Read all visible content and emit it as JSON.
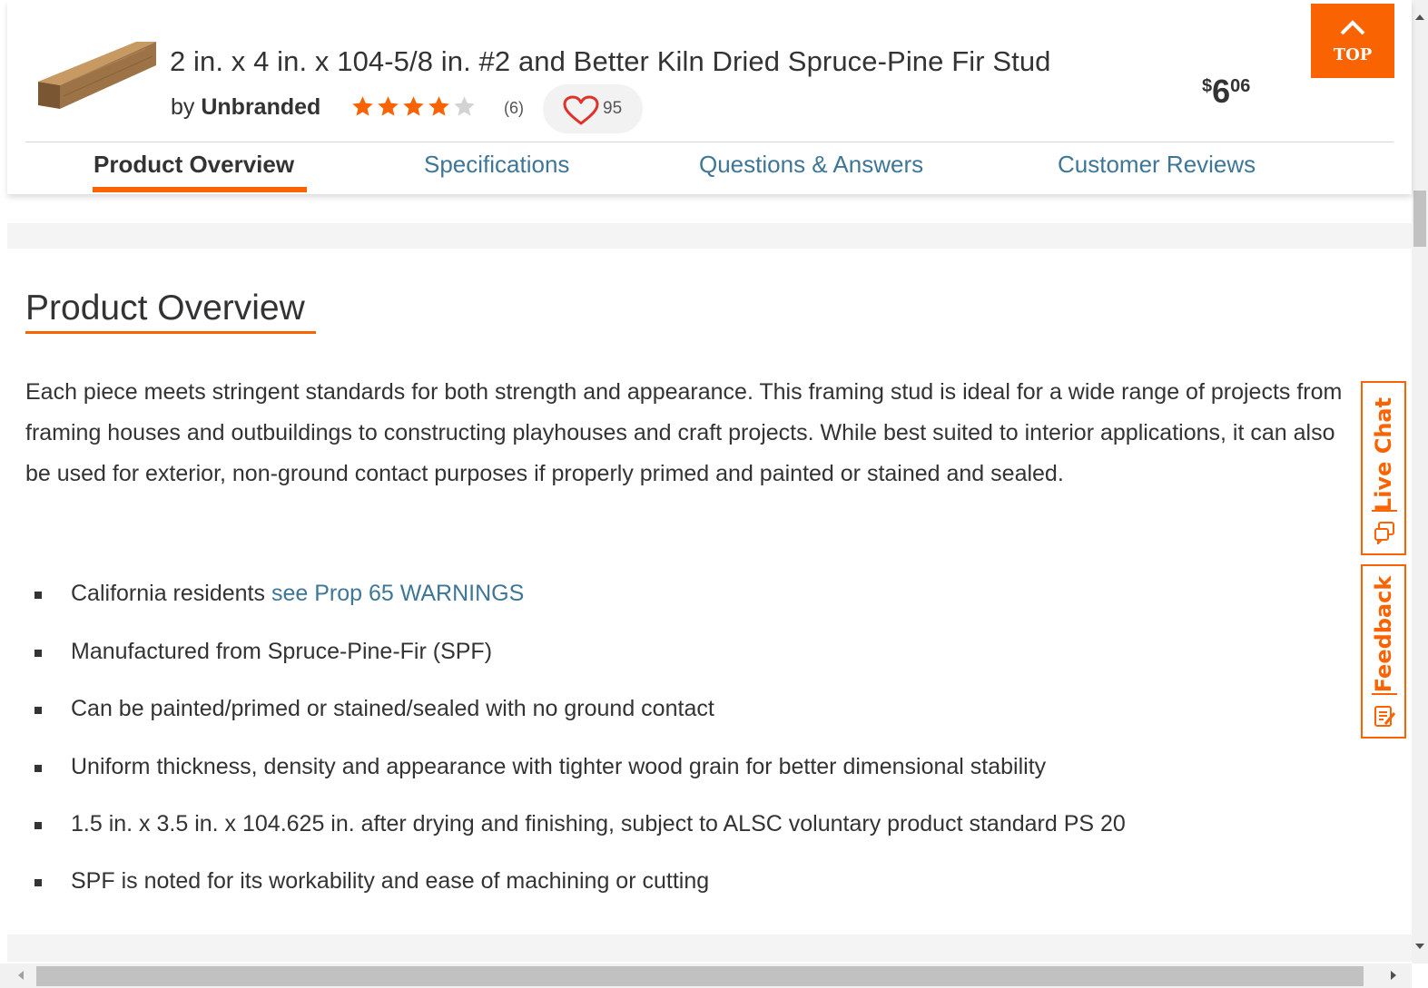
{
  "header": {
    "product_title": "2 in. x 4 in. x 104-5/8 in. #2 and Better Kiln Dried Spruce-Pine Fir Stud",
    "by_prefix": "by",
    "brand": "Unbranded",
    "rating": {
      "value": 4,
      "max": 5
    },
    "review_count": "(6)",
    "favorites_count": "95",
    "price": {
      "currency": "$",
      "dollars": "6",
      "cents": "06"
    },
    "top_button_label": "TOP",
    "tabs": [
      {
        "label": "Product Overview",
        "active": true
      },
      {
        "label": "Specifications",
        "active": false
      },
      {
        "label": "Questions & Answers",
        "active": false
      },
      {
        "label": "Customer Reviews",
        "active": false
      }
    ]
  },
  "overview": {
    "title": "Product Overview",
    "description": "Each piece meets stringent standards for both strength and appearance. This framing stud is ideal for a wide range of projects from framing houses and outbuildings to constructing playhouses and craft projects. While best suited to interior applications, it can also be used for exterior, non-ground contact purposes if properly primed and painted or stained and sealed.",
    "prop65_prefix": "California residents",
    "prop65_link": "see Prop 65 WARNINGS",
    "bullets": [
      "Manufactured from Spruce-Pine-Fir (SPF)",
      "Can be painted/primed or stained/sealed with no ground contact",
      "Uniform thickness, density and appearance with tighter wood grain for better dimensional stability",
      "1.5 in. x 3.5 in. x 104.625 in. after drying and finishing, subject to ALSC voluntary product standard PS 20",
      "SPF is noted for its workability and ease of machining or cutting"
    ]
  },
  "side_tabs": {
    "live_chat": "Live Chat",
    "feedback": "Feedback"
  },
  "colors": {
    "accent": "#f96302",
    "link": "#3e7697",
    "star": "#f96302",
    "text": "#333333"
  },
  "icons": {
    "top": "chevron-up-icon",
    "favorite": "heart-icon",
    "star": "star-icon",
    "chat": "chat-bubbles-icon",
    "feedback": "clipboard-pencil-icon"
  }
}
